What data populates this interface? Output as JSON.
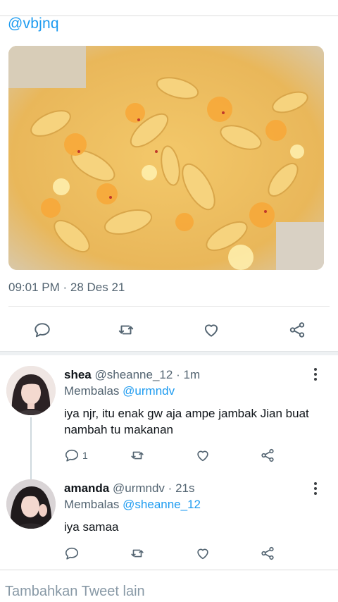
{
  "tweet": {
    "mention": "@vbjnq",
    "timestamp": "09:01 PM · 28 Des 21",
    "photo_icon": "pasta-photo"
  },
  "actions": {
    "icons": [
      "reply-icon",
      "retweet-icon",
      "like-icon",
      "share-icon"
    ]
  },
  "replies": [
    {
      "name": "shea",
      "handle": "@sheanne_12",
      "dot": "·",
      "time": "1m",
      "replying_label": "Membalas",
      "replying_to": "@urmndv",
      "text": "iya njr, itu enak gw aja ampe jambak Jian buat nambah tu makanan",
      "reply_count": "1"
    },
    {
      "name": "amanda",
      "handle": "@urmndv",
      "dot": "·",
      "time": "21s",
      "replying_label": "Membalas",
      "replying_to": "@sheanne_12",
      "text": "iya samaa",
      "reply_count": ""
    }
  ],
  "composer": {
    "placeholder": "Tambahkan Tweet lain"
  },
  "colors": {
    "accent": "#1d9bf0",
    "secondary_text": "#536471",
    "icon": "#536471"
  }
}
